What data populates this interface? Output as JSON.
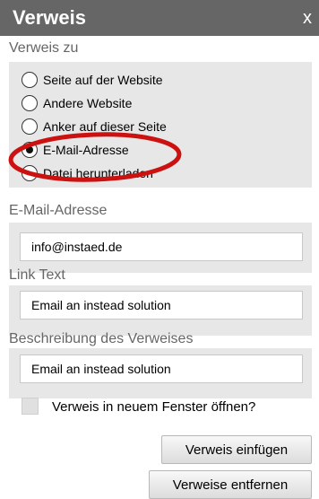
{
  "dialog": {
    "title": "Verweis",
    "close_glyph": "x"
  },
  "link_to": {
    "label": "Verweis zu",
    "options": [
      {
        "label": "Seite auf der Website",
        "selected": false
      },
      {
        "label": "Andere Website",
        "selected": false
      },
      {
        "label": "Anker auf dieser Seite",
        "selected": false
      },
      {
        "label": "E-Mail-Adresse",
        "selected": true
      },
      {
        "label": "Datei herunterladen",
        "selected": false
      }
    ],
    "highlight_color": "#cc1111"
  },
  "email": {
    "label": "E-Mail-Adresse",
    "value": "info@instaed.de"
  },
  "link_text": {
    "label": "Link Text",
    "value": "Email an instead solution"
  },
  "description": {
    "label": "Beschreibung des Verweises",
    "value": "Email an instead solution"
  },
  "new_window": {
    "label": "Verweis in neuem Fenster öffnen?",
    "checked": false
  },
  "buttons": {
    "insert": "Verweis einfügen",
    "remove": "Verweise entfernen"
  }
}
